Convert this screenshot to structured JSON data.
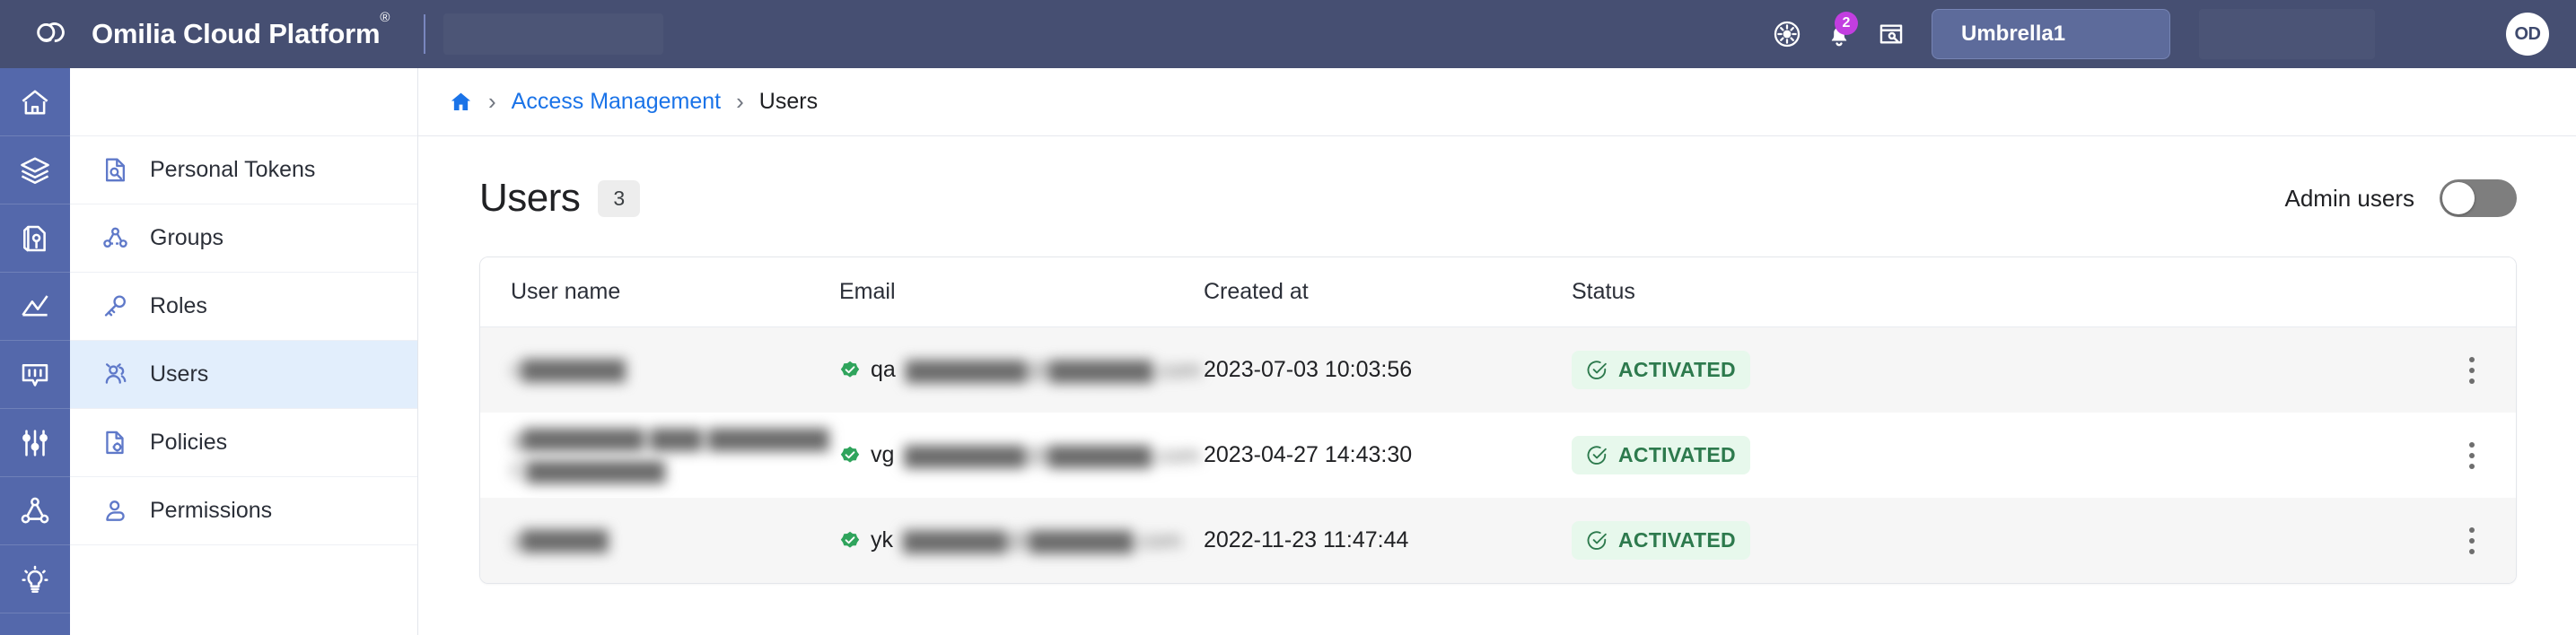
{
  "topbar": {
    "logo_icon": "omilia-cloud-logo-icon",
    "brand_name": "Omilia Cloud Platform",
    "brand_trademark": "®",
    "icons": [
      {
        "name": "theme-sun-icon",
        "label": "Theme"
      },
      {
        "name": "notifications-bell-icon",
        "label": "Notifications",
        "badge": "2"
      },
      {
        "name": "credentials-window-key-icon",
        "label": "Credentials"
      }
    ],
    "tenant_selector": "Umbrella1",
    "avatar_initials": "OD",
    "badge_color": "#c23ee0",
    "background_color": "#464f72"
  },
  "rail": {
    "items": [
      {
        "name": "rail-home",
        "icon": "home-icon"
      },
      {
        "name": "rail-layers",
        "icon": "layers-icon"
      },
      {
        "name": "rail-tag",
        "icon": "tag-cube-icon"
      },
      {
        "name": "rail-analytics",
        "icon": "analytics-chart-icon"
      },
      {
        "name": "rail-dialog",
        "icon": "speech-bubble-icon"
      },
      {
        "name": "rail-settings",
        "icon": "sliders-icon"
      },
      {
        "name": "rail-graph",
        "icon": "network-graph-icon"
      },
      {
        "name": "rail-insights",
        "icon": "lightbulb-icon"
      }
    ],
    "background_color": "#5468ab"
  },
  "sidebar": {
    "items": [
      {
        "label": "Personal Tokens",
        "icon": "document-search-icon",
        "active": false
      },
      {
        "label": "Groups",
        "icon": "groups-nodes-icon",
        "active": false
      },
      {
        "label": "Roles",
        "icon": "key-icon",
        "active": false
      },
      {
        "label": "Users",
        "icon": "users-icon",
        "active": true
      },
      {
        "label": "Policies",
        "icon": "document-gear-icon",
        "active": false
      },
      {
        "label": "Permissions",
        "icon": "user-permission-icon",
        "active": false
      }
    ],
    "active_background": "#e2eefc"
  },
  "breadcrumb": {
    "home_icon": "home-icon",
    "separator": "›",
    "link": "Access Management",
    "current": "Users"
  },
  "page": {
    "title": "Users",
    "count": "3",
    "admin_toggle_label": "Admin users",
    "admin_toggle_state": "off"
  },
  "table": {
    "columns": [
      "User name",
      "Email",
      "Created at",
      "Status"
    ],
    "rows": [
      {
        "user_name_lines": [
          "c▇▇▇▇▇▇"
        ],
        "email_prefix": "qa",
        "email_blurred": "▇▇▇▇▇▇▇@▇▇▇▇▇▇.com",
        "email_verified_icon": "verified-check-icon",
        "created_at": "2023-07-03 10:03:56",
        "status": "ACTIVATED",
        "status_icon": "check-circle-icon",
        "menu_icon": "kebab-menu-icon"
      },
      {
        "user_name_lines": [
          "g▇▇▇▇▇▇▇ ▇▇▇ ▇▇▇▇▇▇▇",
          "C▇▇▇▇▇▇▇▇"
        ],
        "email_prefix": "vg",
        "email_blurred": "▇▇▇▇▇▇▇@▇▇▇▇▇▇.com",
        "email_verified_icon": "verified-check-icon",
        "created_at": "2023-04-27 14:43:30",
        "status": "ACTIVATED",
        "status_icon": "check-circle-icon",
        "menu_icon": "kebab-menu-icon"
      },
      {
        "user_name_lines": [
          "y▇▇▇▇▇"
        ],
        "email_prefix": "yk",
        "email_blurred": "▇▇▇▇▇▇@▇▇▇▇▇▇.com",
        "email_verified_icon": "verified-check-icon",
        "created_at": "2022-11-23 11:47:44",
        "status": "ACTIVATED",
        "status_icon": "check-circle-icon",
        "menu_icon": "kebab-menu-icon"
      }
    ],
    "status_text_color": "#2d7a4d",
    "status_bg_color": "#e7f8ec"
  }
}
